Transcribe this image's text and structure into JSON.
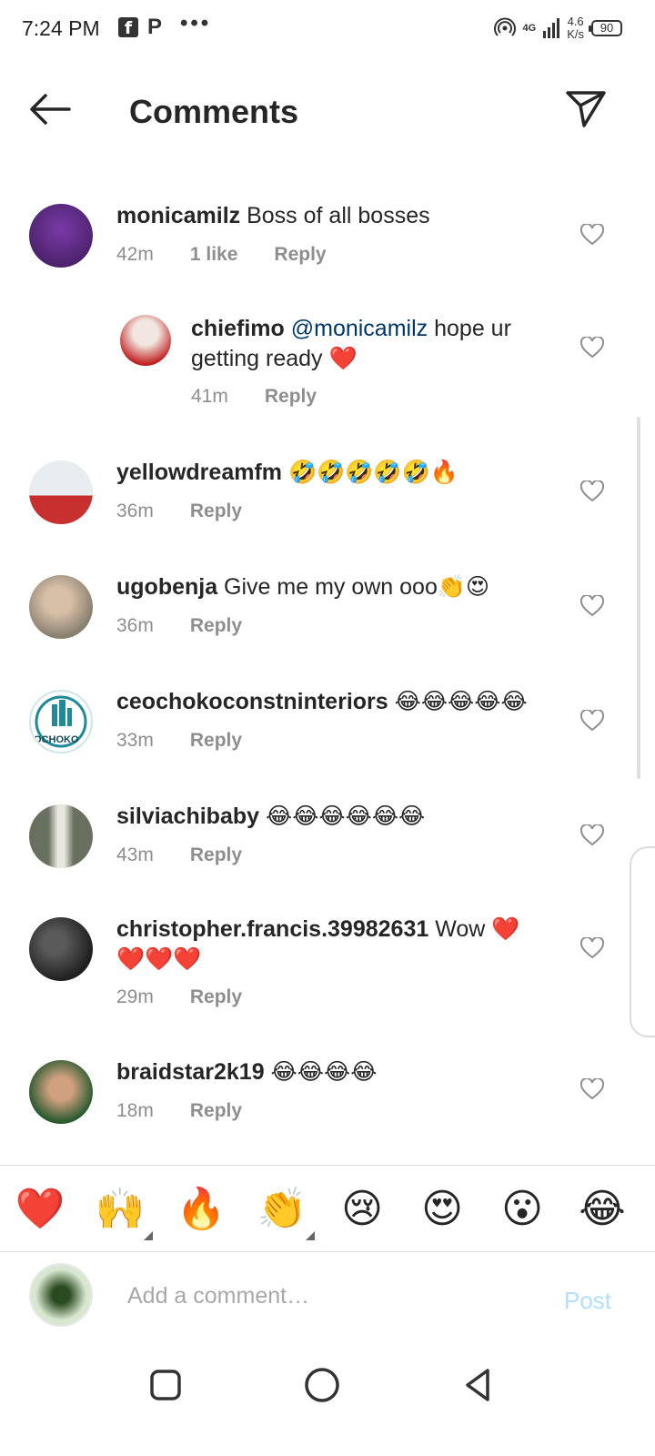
{
  "status_bar": {
    "time": "7:24 PM",
    "fb_glyph": "f",
    "p_glyph": "P",
    "dots": "•••",
    "network": "4G",
    "speed_value": "4.6",
    "speed_unit": "K/s",
    "battery": "90",
    "icons": [
      "facebook-icon",
      "p-app-icon",
      "hotspot-icon",
      "signal-icon",
      "battery-icon"
    ]
  },
  "header": {
    "title": "Comments",
    "back_icon": "arrow-left-icon",
    "share_icon": "send-icon"
  },
  "comments": [
    {
      "username": "monicamilz",
      "mention": "",
      "text": " Boss of all bosses",
      "line2": "",
      "time": "42m",
      "likes": "1 like",
      "reply": "Reply",
      "is_reply": false,
      "avatar_colors": [
        "#3a1a55",
        "#7a3aa8"
      ]
    },
    {
      "username": "chiefimo",
      "mention": " @monicamilz",
      "text": " hope ur",
      "line2": "getting ready ❤️",
      "time": "41m",
      "likes": "",
      "reply": "Reply",
      "is_reply": true,
      "avatar_colors": [
        "#c02020",
        "#f2e6e0"
      ]
    },
    {
      "username": "yellowdreamfm",
      "mention": "",
      "text": " 🤣🤣🤣🤣🤣🔥",
      "line2": "",
      "time": "36m",
      "likes": "",
      "reply": "Reply",
      "is_reply": false,
      "avatar_colors": [
        "#e8eef0",
        "#c83030"
      ]
    },
    {
      "username": "ugobenja",
      "mention": "",
      "text": " Give me my own ooo👏😍",
      "line2": "",
      "time": "36m",
      "likes": "",
      "reply": "Reply",
      "is_reply": false,
      "avatar_colors": [
        "#8a8070",
        "#d8c0a8"
      ]
    },
    {
      "username": "ceochokoconstninteriors",
      "mention": "",
      "text": " 😂😂😂😂😂",
      "line2": "",
      "time": "33m",
      "likes": "",
      "reply": "Reply",
      "is_reply": false,
      "avatar_colors": [
        "#ffffff",
        "#1f8a9a"
      ],
      "avatar_label": "OCHOKO"
    },
    {
      "username": "silviachibaby",
      "mention": "",
      "text": " 😂😂😂😂😂😂",
      "line2": "",
      "time": "43m",
      "likes": "",
      "reply": "Reply",
      "is_reply": false,
      "avatar_colors": [
        "#6a7060",
        "#e8e8e0"
      ]
    },
    {
      "username": "christopher.francis.39982631",
      "mention": "",
      "text": " Wow ❤️",
      "line2": "❤️❤️❤️",
      "time": "29m",
      "likes": "",
      "reply": "Reply",
      "is_reply": false,
      "avatar_colors": [
        "#202020",
        "#5a5a5a"
      ]
    },
    {
      "username": "braidstar2k19",
      "mention": "",
      "text": " 😂😂😂😂",
      "line2": "",
      "time": "18m",
      "likes": "",
      "reply": "Reply",
      "is_reply": false,
      "avatar_colors": [
        "#2a5a30",
        "#d0a080"
      ]
    }
  ],
  "emoji_bar": [
    "❤️",
    "🙌",
    "🔥",
    "👏",
    "😢",
    "😍",
    "😮",
    "😂"
  ],
  "composer": {
    "placeholder": "Add a comment…",
    "post_label": "Post",
    "avatar_colors": [
      "#d8e8d0",
      "#2a4a20"
    ]
  },
  "nav_bar": {
    "icons": [
      "recents-square-icon",
      "home-circle-icon",
      "back-triangle-icon"
    ]
  },
  "colors": {
    "text": "#262626",
    "meta": "#8e8e8e",
    "mention": "#00376b",
    "post_disabled": "#b2dffc",
    "divider": "#dbdbdb"
  }
}
